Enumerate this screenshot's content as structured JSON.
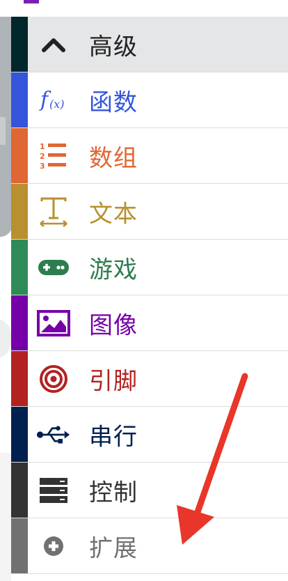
{
  "menu": {
    "items": [
      {
        "label": "高级",
        "color": "#00272b",
        "text_color": "#222222",
        "icon": "chevron-up-icon",
        "active": true
      },
      {
        "label": "函数",
        "color": "#3455db",
        "text_color": "#3455db",
        "icon": "function-icon"
      },
      {
        "label": "数组",
        "color": "#e06733",
        "text_color": "#e06733",
        "icon": "list-numbered-icon"
      },
      {
        "label": "文本",
        "color": "#b8902f",
        "text_color": "#b8902f",
        "icon": "text-icon"
      },
      {
        "label": "游戏",
        "color": "#2e8b57",
        "text_color": "#2e7d4f",
        "icon": "gamepad-icon"
      },
      {
        "label": "图像",
        "color": "#7600a8",
        "text_color": "#7600a8",
        "icon": "image-icon"
      },
      {
        "label": "引脚",
        "color": "#b22222",
        "text_color": "#b22222",
        "icon": "target-icon"
      },
      {
        "label": "串行",
        "color": "#002050",
        "text_color": "#002050",
        "icon": "usb-icon"
      },
      {
        "label": "控制",
        "color": "#333333",
        "text_color": "#333333",
        "icon": "server-icon"
      },
      {
        "label": "扩展",
        "color": "#717171",
        "text_color": "#717171",
        "icon": "plus-circle-icon"
      }
    ]
  },
  "annotation": {
    "color": "#e8362a"
  }
}
